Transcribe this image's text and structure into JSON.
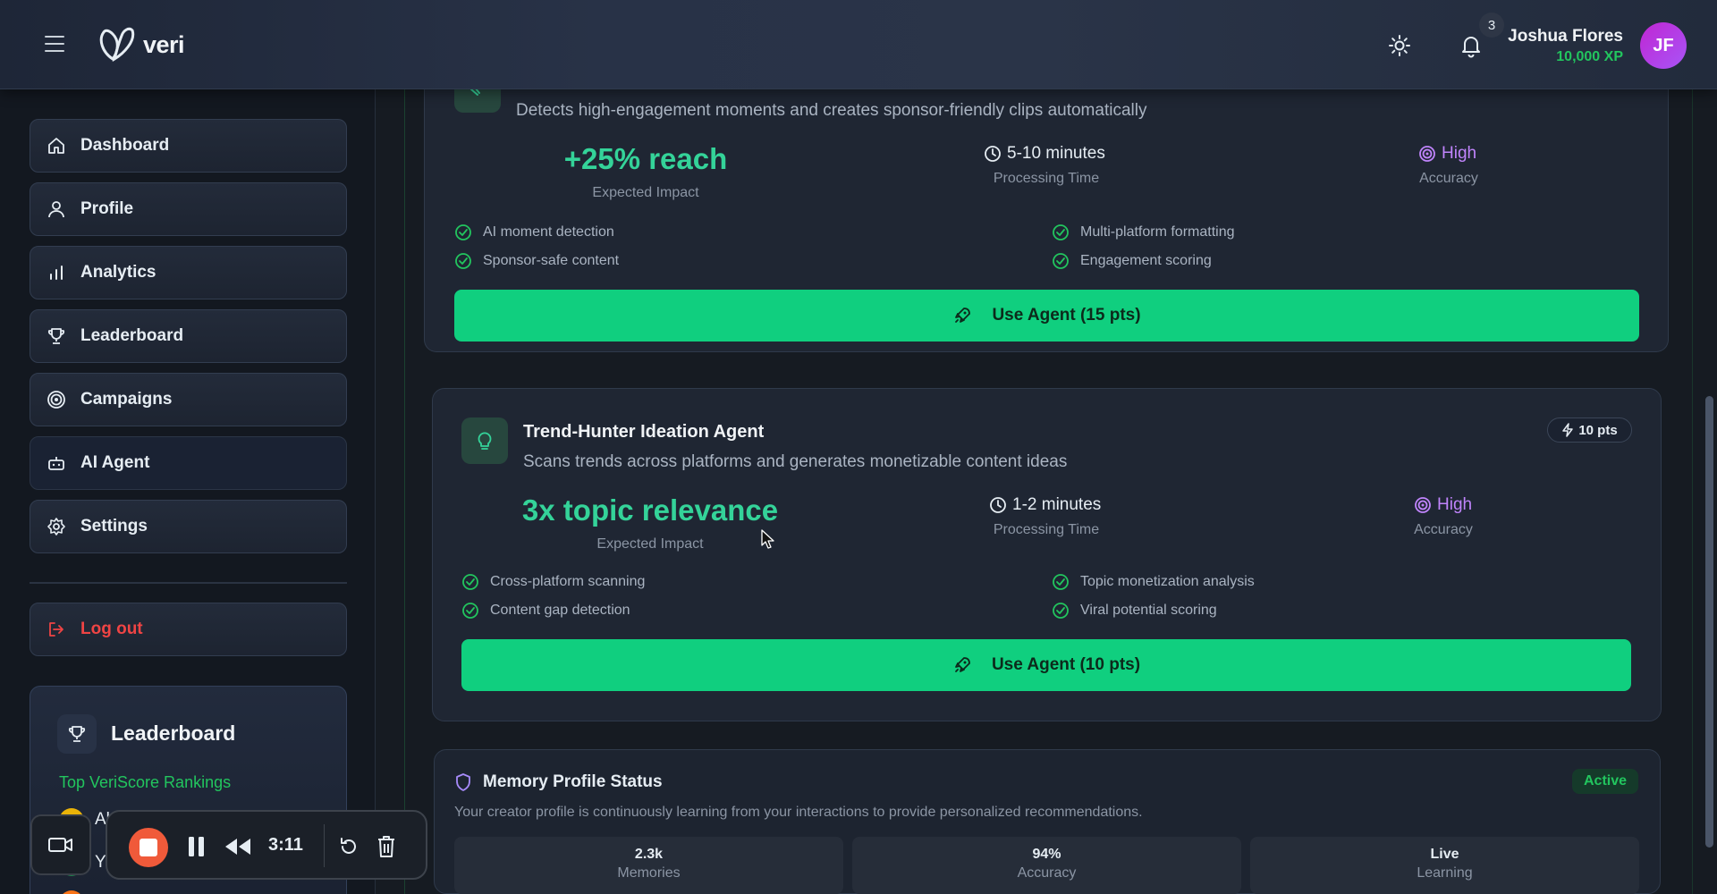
{
  "header": {
    "app_name": "veri",
    "notification_count": "3",
    "user_name": "Joshua Flores",
    "user_xp": "10,000 XP",
    "avatar_initials": "JF"
  },
  "sidebar": {
    "items": [
      {
        "label": "Dashboard",
        "icon": "home-icon"
      },
      {
        "label": "Profile",
        "icon": "user-icon"
      },
      {
        "label": "Analytics",
        "icon": "bar-chart-icon"
      },
      {
        "label": "Leaderboard",
        "icon": "trophy-icon"
      },
      {
        "label": "Campaigns",
        "icon": "target-icon"
      },
      {
        "label": "AI Agent",
        "icon": "bot-icon"
      },
      {
        "label": "Settings",
        "icon": "gear-icon"
      }
    ],
    "logout_label": "Log out",
    "leaderboard_widget": {
      "title": "Leaderboard",
      "subtitle": "Top VeriScore Rankings",
      "partial_row_1": "Ale",
      "partial_row_2": "Y"
    }
  },
  "recorder": {
    "time": "3:11"
  },
  "agents": [
    {
      "description": "Detects high-engagement moments and creates sponsor-friendly clips automatically",
      "impact": "+25% reach",
      "impact_label": "Expected Impact",
      "processing_time": "5-10 minutes",
      "processing_label": "Processing Time",
      "accuracy": "High",
      "accuracy_label": "Accuracy",
      "features": [
        "AI moment detection",
        "Multi-platform formatting",
        "Sponsor-safe content",
        "Engagement scoring"
      ],
      "button_label": "Use Agent (15 pts)"
    },
    {
      "title": "Trend-Hunter Ideation Agent",
      "description": "Scans trends across platforms and generates monetizable content ideas",
      "points": "10 pts",
      "impact": "3x topic relevance",
      "impact_label": "Expected Impact",
      "processing_time": "1-2 minutes",
      "processing_label": "Processing Time",
      "accuracy": "High",
      "accuracy_label": "Accuracy",
      "features": [
        "Cross-platform scanning",
        "Topic monetization analysis",
        "Content gap detection",
        "Viral potential scoring"
      ],
      "button_label": "Use Agent (10 pts)"
    }
  ],
  "memory": {
    "title": "Memory Profile Status",
    "status": "Active",
    "description": "Your creator profile is continuously learning from your interactions to provide personalized recommendations.",
    "stats": [
      {
        "value": "2.3k",
        "label": "Memories"
      },
      {
        "value": "94%",
        "label": "Accuracy"
      },
      {
        "value": "Live",
        "label": "Learning"
      }
    ]
  },
  "colors": {
    "accent_green": "#10cf7f",
    "impact_green": "#34d399",
    "accuracy_purple": "#c084fc",
    "logout_red": "#ef4444",
    "avatar_purple": "#c026d3"
  }
}
